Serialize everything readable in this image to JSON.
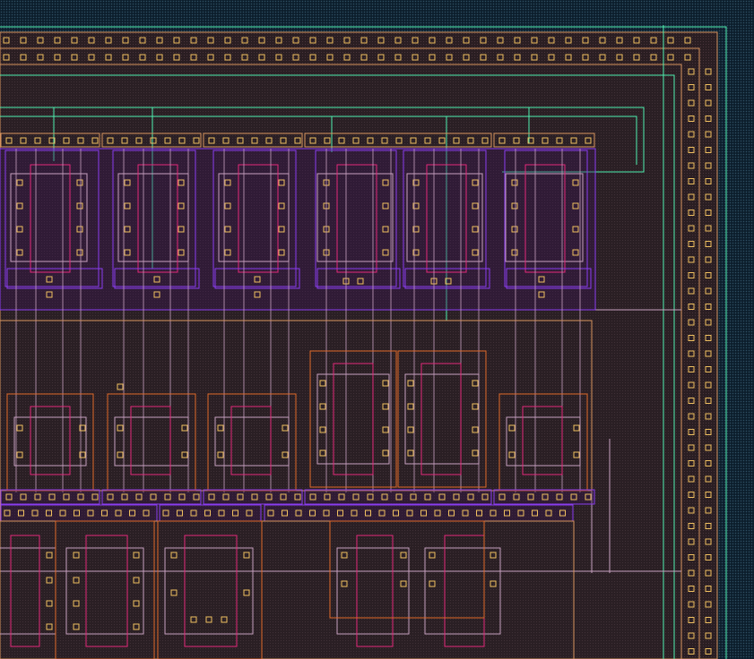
{
  "app": {
    "view": "layout-editor-canvas"
  },
  "colors": {
    "background": "#0c1e2c",
    "outer_fill": "#2a1e22",
    "dot_pattern": "#2f4f63",
    "boundary_nwell": "#d8945e",
    "metal1": "#c7a0c0",
    "metal2": "#8a3cf0",
    "metal3": "#4ff0b0",
    "poly": "#e3287a",
    "diffusion": "#e06a28",
    "contact": "#f0c060",
    "via": "#a070ff"
  },
  "layers": [
    {
      "name": "nwell",
      "color_key": "boundary_nwell"
    },
    {
      "name": "diffusion",
      "color_key": "diffusion"
    },
    {
      "name": "poly",
      "color_key": "poly"
    },
    {
      "name": "contact",
      "color_key": "contact"
    },
    {
      "name": "metal1",
      "color_key": "metal1"
    },
    {
      "name": "metal2",
      "color_key": "metal2"
    },
    {
      "name": "metal3",
      "color_key": "metal3"
    }
  ],
  "cells": {
    "upper_transistor_count": 6,
    "middle_transistor_count": 6,
    "lower_transistor_count": 5,
    "guard_ring": true
  }
}
